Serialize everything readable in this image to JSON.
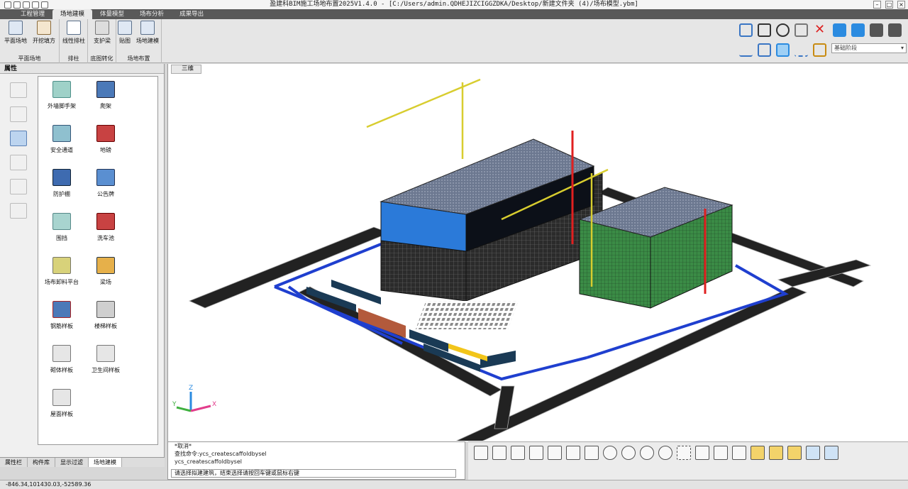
{
  "title": "盈建科BIM施工场地布置2025V1.4.0 - [C:/Users/admin.QDHEJIZCIGGZDKA/Desktop/新建文件夹 (4)/场布模型.ybm]",
  "tabs": [
    "工程管理",
    "场地建模",
    "体量模型",
    "场布分析",
    "成果导出"
  ],
  "active_tab": "场地建模",
  "ribbon": {
    "buttons": [
      "平面场地",
      "开挖填方",
      "线性排柱",
      "支护梁",
      "贴图",
      "场地建模"
    ],
    "groups": [
      "平面场地",
      "排柱",
      "底图转化",
      "场地布置"
    ]
  },
  "phase_select": "基础阶段",
  "panel_title": "属性",
  "items": [
    "外墙脚手架",
    "爬架",
    "安全通道",
    "地磅",
    "防护棚",
    "公告牌",
    "围挡",
    "洗车池",
    "场布卸料平台",
    "梁场",
    "钢筋样板",
    "楼梯样板",
    "砌体样板",
    "卫生间样板",
    "屋面样板"
  ],
  "panel_tabs": [
    "属性栏",
    "构件库",
    "显示过滤",
    "场地建模"
  ],
  "viewport_tab": "三维",
  "cmd_lines": [
    "*取消*",
    "查找命令:ycs_createscaffoldbysel",
    "ycs_createscaffoldbysel"
  ],
  "cmd_prompt": "请选择拟建建筑，结束选择请按回车键或鼠标右键",
  "coords": "-846.34,101430.03,-52589.36",
  "axis": {
    "z": "Z",
    "y": "Y",
    "x": "X"
  },
  "colors": {
    "accent": "#3a76c4",
    "crane": "#d8cd2f",
    "road": "#222222",
    "fence": "#1f3fcf",
    "roof": "#6c7890",
    "green": "#3e8c4a",
    "court": "#b35a3c"
  }
}
